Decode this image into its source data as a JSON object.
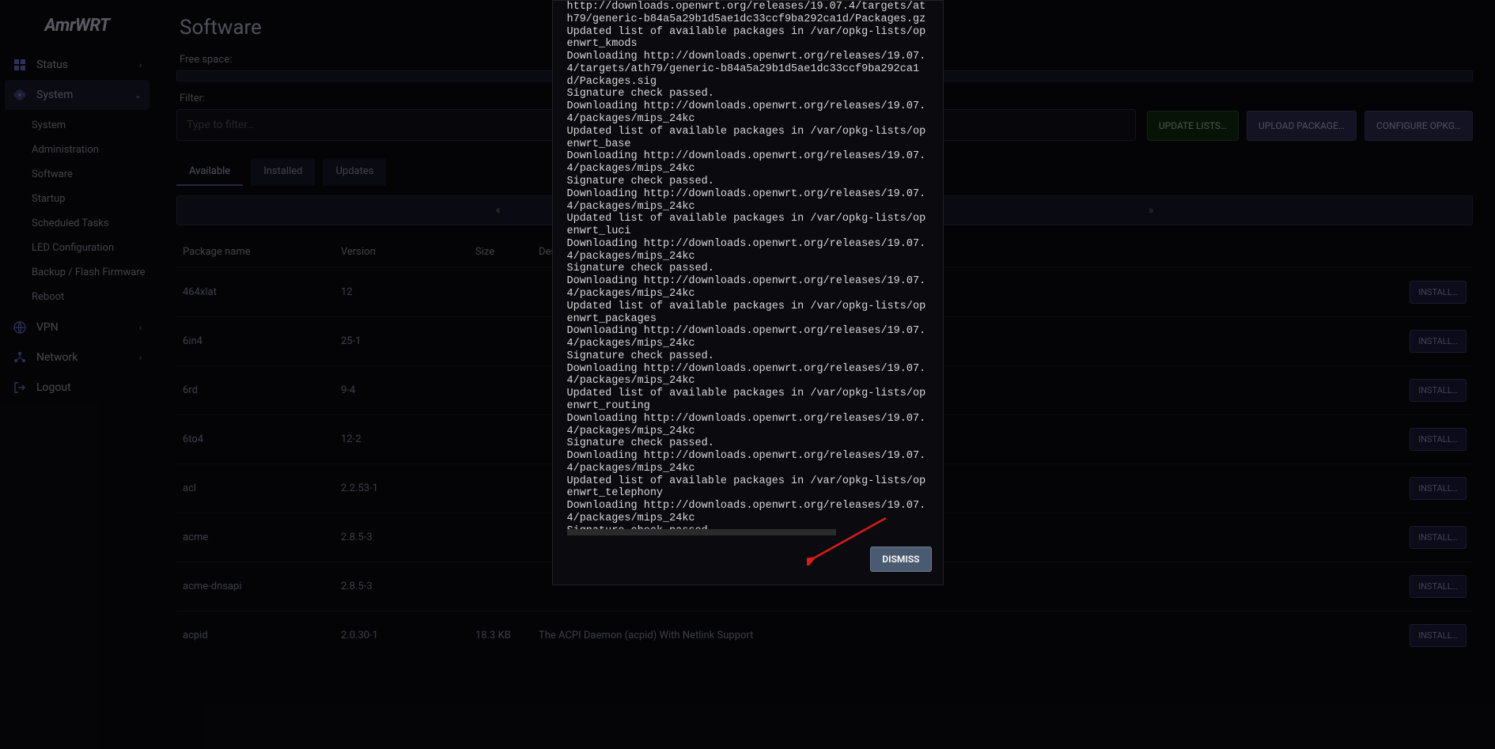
{
  "logo": "AmrWRT",
  "nav": {
    "status": "Status",
    "system": "System",
    "system_sub": [
      "System",
      "Administration",
      "Software",
      "Startup",
      "Scheduled Tasks",
      "LED Configuration",
      "Backup / Flash Firmware",
      "Reboot"
    ],
    "vpn": "VPN",
    "network": "Network",
    "logout": "Logout"
  },
  "page": {
    "title": "Software",
    "free_space_label": "Free space:",
    "filter_label": "Filter:",
    "filter_placeholder": "Type to filter…",
    "btn_update": "UPDATE LISTS…",
    "btn_upload": "UPLOAD PACKAGE…",
    "btn_config": "CONFIGURE OPKG…"
  },
  "tabs": {
    "available": "Available",
    "installed": "Installed",
    "updates": "Updates"
  },
  "table": {
    "headers": {
      "name": "Package name",
      "version": "Version",
      "size": "Size",
      "desc": "Description"
    },
    "install_label": "INSTALL…",
    "rows": [
      {
        "name": "464xlat",
        "ver": "12",
        "size": "",
        "desc": ""
      },
      {
        "name": "6in4",
        "ver": "25-1",
        "size": "",
        "desc": ""
      },
      {
        "name": "6rd",
        "ver": "9-4",
        "size": "",
        "desc": ""
      },
      {
        "name": "6to4",
        "ver": "12-2",
        "size": "",
        "desc": ""
      },
      {
        "name": "acl",
        "ver": "2.2.53-1",
        "size": "",
        "desc": ""
      },
      {
        "name": "acme",
        "ver": "2.8.5-3",
        "size": "",
        "desc": ""
      },
      {
        "name": "acme-dnsapi",
        "ver": "2.8.5-3",
        "size": "",
        "desc": ""
      },
      {
        "name": "acpid",
        "ver": "2.0.30-1",
        "size": "18.3 KB",
        "desc": "The ACPI Daemon (acpid) With Netlink Support"
      }
    ]
  },
  "modal": {
    "log": "http://downloads.openwrt.org/releases/19.07.4/targets/ath79/generic-b84a5a29b1d5ae1dc33ccf9ba292ca1d/Packages.gz\nUpdated list of available packages in /var/opkg-lists/openwrt_kmods\nDownloading http://downloads.openwrt.org/releases/19.07.4/targets/ath79/generic-b84a5a29b1d5ae1dc33ccf9ba292ca1d/Packages.sig\nSignature check passed.\nDownloading http://downloads.openwrt.org/releases/19.07.4/packages/mips_24kc\nUpdated list of available packages in /var/opkg-lists/openwrt_base\nDownloading http://downloads.openwrt.org/releases/19.07.4/packages/mips_24kc\nSignature check passed.\nDownloading http://downloads.openwrt.org/releases/19.07.4/packages/mips_24kc\nUpdated list of available packages in /var/opkg-lists/openwrt_luci\nDownloading http://downloads.openwrt.org/releases/19.07.4/packages/mips_24kc\nSignature check passed.\nDownloading http://downloads.openwrt.org/releases/19.07.4/packages/mips_24kc\nUpdated list of available packages in /var/opkg-lists/openwrt_packages\nDownloading http://downloads.openwrt.org/releases/19.07.4/packages/mips_24kc\nSignature check passed.\nDownloading http://downloads.openwrt.org/releases/19.07.4/packages/mips_24kc\nUpdated list of available packages in /var/opkg-lists/openwrt_routing\nDownloading http://downloads.openwrt.org/releases/19.07.4/packages/mips_24kc\nSignature check passed.\nDownloading http://downloads.openwrt.org/releases/19.07.4/packages/mips_24kc\nUpdated list of available packages in /var/opkg-lists/openwrt_telephony\nDownloading http://downloads.openwrt.org/releases/19.07.4/packages/mips_24kc\nSignature check passed.",
    "dismiss": "DISMISS"
  }
}
